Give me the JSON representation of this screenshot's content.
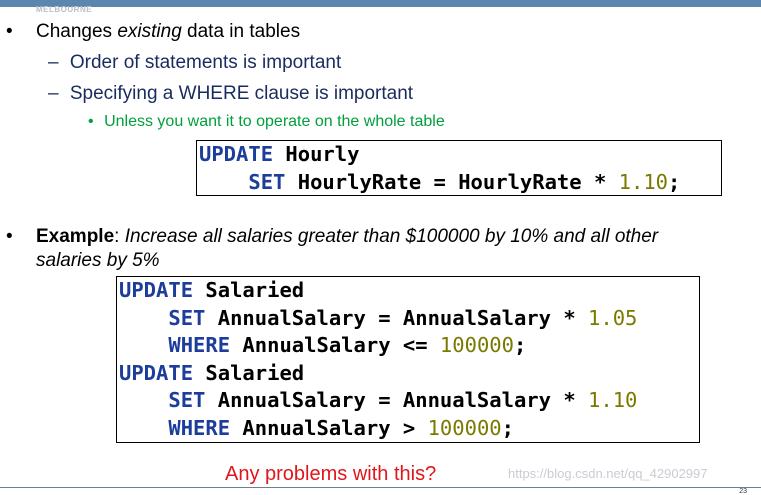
{
  "header": {
    "logo_text": "MELBOURNE"
  },
  "bullets": {
    "b1_prefix": "Changes ",
    "b1_em": "existing",
    "b1_suffix": " data in tables",
    "sub1": "Order of statements is important",
    "sub2": "Specifying a WHERE clause is important",
    "subsub1": "Unless you want it to operate on the whole table"
  },
  "code1": {
    "l1_kw": "UPDATE",
    "l1_id": " Hourly",
    "l2_kw": "SET",
    "l2_id": " HourlyRate = HourlyRate * ",
    "l2_num": "1.10",
    "l2_end": ";"
  },
  "example": {
    "label": "Example",
    "colon": ": ",
    "text_line1": "Increase all salaries greater than $100000 by 10% and all other",
    "text_line2": "salaries by 5%"
  },
  "code2": {
    "a1_kw": "UPDATE",
    "a1_id": " Salaried",
    "a2_kw": "SET",
    "a2_id": " AnnualSalary = AnnualSalary * ",
    "a2_num": "1.05",
    "a3_kw": "WHERE",
    "a3_id": " AnnualSalary <= ",
    "a3_num": "100000",
    "a3_end": ";",
    "b1_kw": "UPDATE",
    "b1_id": " Salaried",
    "b2_kw": "SET",
    "b2_id": " AnnualSalary = AnnualSalary * ",
    "b2_num": "1.10",
    "b3_kw": "WHERE",
    "b3_id": " AnnualSalary > ",
    "b3_num": "100000",
    "b3_end": ";"
  },
  "question": "Any problems with this?",
  "watermark": "https://blog.csdn.net/qq_42902997",
  "page_number": "23",
  "bullet_glyph": "•",
  "dash_glyph": "–",
  "colors": {
    "topbar": "#5b86b0",
    "keyword": "#1d3d9a",
    "number": "#7a7a00",
    "subbullet": "#1a2c5e",
    "green": "#00a03a",
    "question": "#e0161c"
  }
}
